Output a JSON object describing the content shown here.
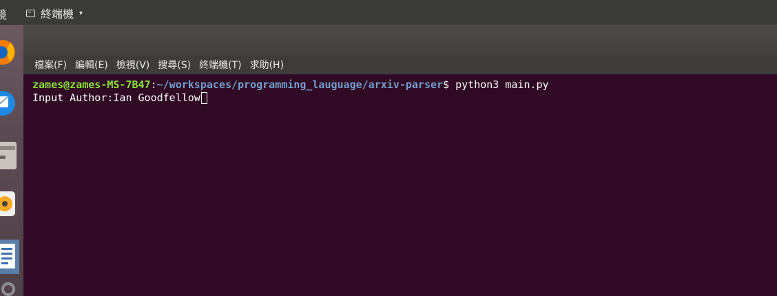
{
  "topbar": {
    "partial_text": "境",
    "app_name": "終端機",
    "caret": "▾"
  },
  "menu": [
    "檔案(F)",
    "編輯(E)",
    "檢視(V)",
    "搜尋(S)",
    "終端機(T)",
    "求助(H)"
  ],
  "terminal": {
    "prompt_user": "zames@zames-MS-7B47",
    "prompt_sep": ":",
    "prompt_path": "~/workspaces/programming_lauguage/arxiv-parser",
    "prompt_symbol": "$ ",
    "command": "python3 main.py",
    "input_line": "Input Author:Ian Goodfellow"
  },
  "colors": {
    "terminal_bg": "#300a24",
    "prompt_user": "#8ae234",
    "prompt_path": "#729fcf"
  }
}
